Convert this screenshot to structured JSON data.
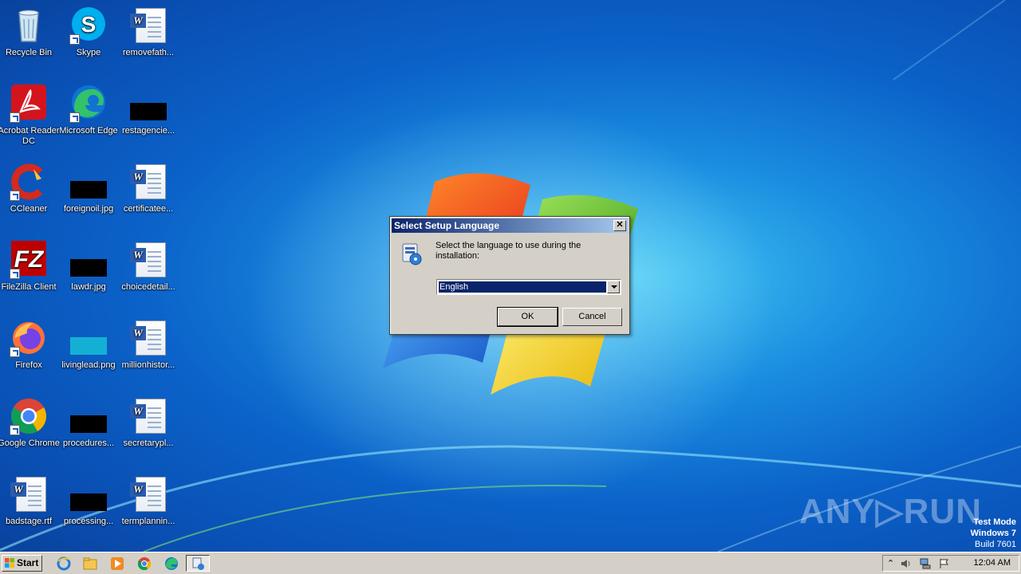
{
  "desktop": {
    "icons": [
      {
        "label": "Recycle Bin"
      },
      {
        "label": "Skype"
      },
      {
        "label": "removefath..."
      },
      {
        "label": "Acrobat Reader DC"
      },
      {
        "label": "Microsoft Edge"
      },
      {
        "label": "restagencie..."
      },
      {
        "label": "CCleaner"
      },
      {
        "label": "foreignoil.jpg"
      },
      {
        "label": "certificatee..."
      },
      {
        "label": "FileZilla Client"
      },
      {
        "label": "lawdr.jpg"
      },
      {
        "label": "choicedetail..."
      },
      {
        "label": "Firefox"
      },
      {
        "label": "livinglead.png"
      },
      {
        "label": "millionhistor..."
      },
      {
        "label": "Google Chrome"
      },
      {
        "label": "procedures..."
      },
      {
        "label": "secretarypl..."
      },
      {
        "label": "badstage.rtf"
      },
      {
        "label": "processing..."
      },
      {
        "label": "termplannin..."
      }
    ]
  },
  "dialog": {
    "title": "Select Setup Language",
    "close_glyph": "✕",
    "prompt": "Select the language to use during the installation:",
    "language_selected": "English",
    "ok_label": "OK",
    "cancel_label": "Cancel"
  },
  "taskbar": {
    "start_label": "Start",
    "clock": "12:04 AM",
    "tray_up_glyph": "⌃"
  },
  "watermark": {
    "brand": "ANY▷RUN",
    "test_mode": "Test Mode",
    "os": "Windows 7",
    "build": "Build 7601"
  },
  "colors": {
    "title_start": "#0a246a",
    "title_end": "#a6caf0",
    "dialog_face": "#d4d0c8",
    "selection": "#0a246a"
  }
}
